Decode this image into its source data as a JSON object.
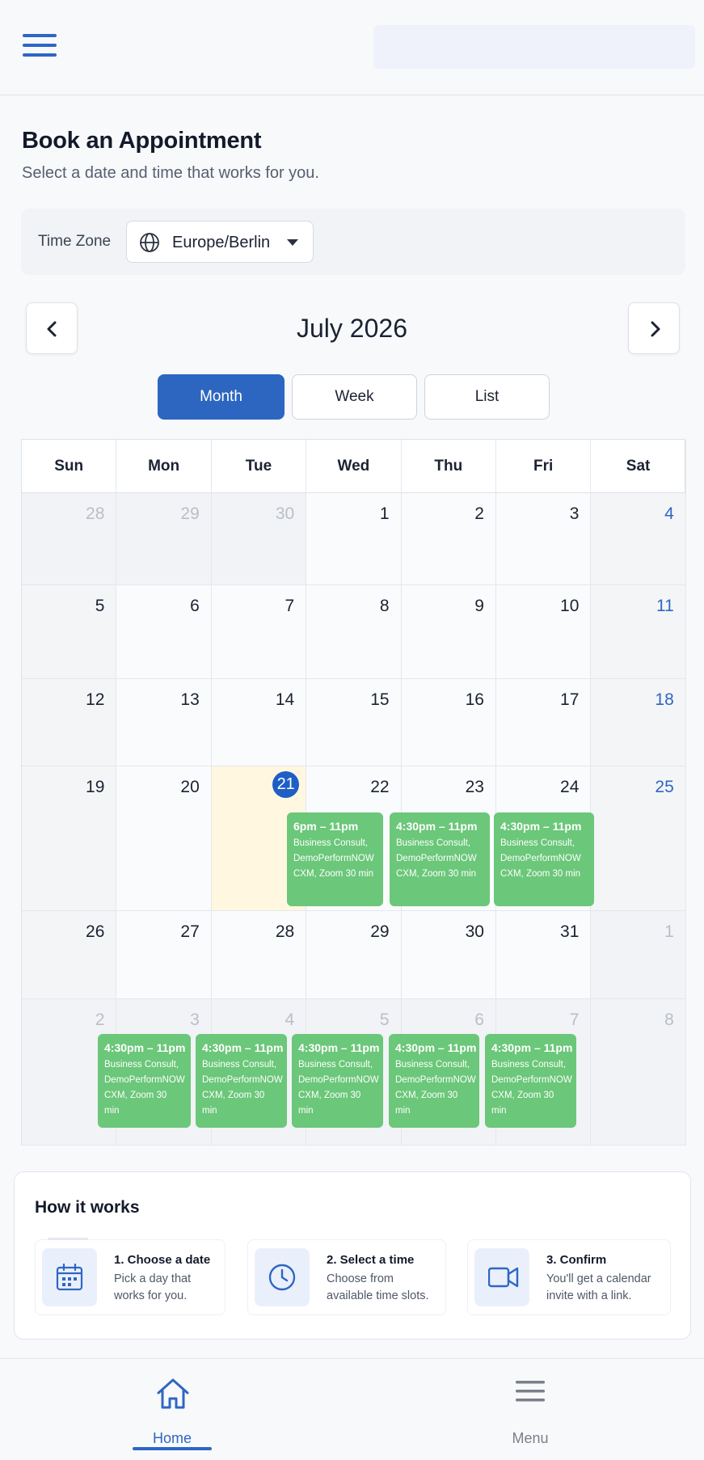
{
  "header": {
    "menu_icon": "hamburger-icon"
  },
  "page": {
    "title": "Book an Appointment",
    "subtitle": "Select a date and time that works for you."
  },
  "timezone": {
    "label": "Time Zone",
    "value": "Europe/Berlin",
    "icon": "globe-icon"
  },
  "calendar": {
    "month_title": "July 2026",
    "views": [
      "Month",
      "Week",
      "List"
    ],
    "active_view": "Month",
    "weekdays": [
      "Sun",
      "Mon",
      "Tue",
      "Wed",
      "Thu",
      "Fri",
      "Sat"
    ],
    "weeks": [
      [
        {
          "d": "28",
          "out": true
        },
        {
          "d": "29",
          "out": true
        },
        {
          "d": "30",
          "out": true
        },
        {
          "d": "1"
        },
        {
          "d": "2"
        },
        {
          "d": "3"
        },
        {
          "d": "4"
        }
      ],
      [
        {
          "d": "5"
        },
        {
          "d": "6"
        },
        {
          "d": "7"
        },
        {
          "d": "8"
        },
        {
          "d": "9"
        },
        {
          "d": "10"
        },
        {
          "d": "11"
        }
      ],
      [
        {
          "d": "12"
        },
        {
          "d": "13"
        },
        {
          "d": "14"
        },
        {
          "d": "15"
        },
        {
          "d": "16"
        },
        {
          "d": "17"
        },
        {
          "d": "18"
        }
      ],
      [
        {
          "d": "19"
        },
        {
          "d": "20"
        },
        {
          "d": "21",
          "today": true
        },
        {
          "d": "22"
        },
        {
          "d": "23"
        },
        {
          "d": "24"
        },
        {
          "d": "25"
        }
      ],
      [
        {
          "d": "26"
        },
        {
          "d": "27"
        },
        {
          "d": "28"
        },
        {
          "d": "29"
        },
        {
          "d": "30"
        },
        {
          "d": "31"
        },
        {
          "d": "1",
          "out": true
        }
      ],
      [
        {
          "d": "2",
          "out": true
        },
        {
          "d": "3",
          "out": true
        },
        {
          "d": "4",
          "out": true
        },
        {
          "d": "5",
          "out": true
        },
        {
          "d": "6",
          "out": true
        },
        {
          "d": "7",
          "out": true
        },
        {
          "d": "8",
          "out": true
        }
      ]
    ],
    "events": [
      {
        "week": 3,
        "day": 3,
        "time": "6pm – 11pm",
        "desc": "Business Consult, DemoPerformNOW CXM, Zoom 30 min"
      },
      {
        "week": 3,
        "day": 4,
        "time": "4:30pm – 11pm",
        "desc": "Business Consult, DemoPerformNOW CXM, Zoom 30 min"
      },
      {
        "week": 3,
        "day": 5,
        "time": "4:30pm – 11pm",
        "desc": "Business Consult, DemoPerformNOW CXM, Zoom 30 min"
      },
      {
        "week": 5,
        "day": 1,
        "time": "4:30pm – 11pm",
        "desc": "Business Consult, DemoPerformNOW CXM, Zoom 30 min"
      },
      {
        "week": 5,
        "day": 2,
        "time": "4:30pm – 11pm",
        "desc": "Business Consult, DemoPerformNOW CXM, Zoom 30 min"
      },
      {
        "week": 5,
        "day": 3,
        "time": "4:30pm – 11pm",
        "desc": "Business Consult, DemoPerformNOW CXM, Zoom 30 min"
      },
      {
        "week": 5,
        "day": 4,
        "time": "4:30pm – 11pm",
        "desc": "Business Consult, DemoPerformNOW CXM, Zoom 30 min"
      },
      {
        "week": 5,
        "day": 5,
        "time": "4:30pm – 11pm",
        "desc": "Business Consult, DemoPerformNOW CXM, Zoom 30 min"
      }
    ],
    "event_color": "#6bc779",
    "today_color": "#1e5ec6",
    "saturday_color": "#2f66c4"
  },
  "how_it_works": {
    "title": "How it works",
    "steps": [
      {
        "title": "1. Choose a date",
        "desc": "Pick a day that works for you.",
        "icon": "calendar-icon"
      },
      {
        "title": "2. Select a time",
        "desc": "Choose from available time slots.",
        "icon": "clock-icon"
      },
      {
        "title": "3. Confirm",
        "desc": "You'll get a calendar invite with a link.",
        "icon": "video-icon"
      }
    ]
  },
  "bottom_nav": {
    "home_label": "Home",
    "menu_label": "Menu",
    "active": "Home"
  },
  "colors": {
    "accent": "#2c66c0",
    "background": "#f8f9fb"
  }
}
